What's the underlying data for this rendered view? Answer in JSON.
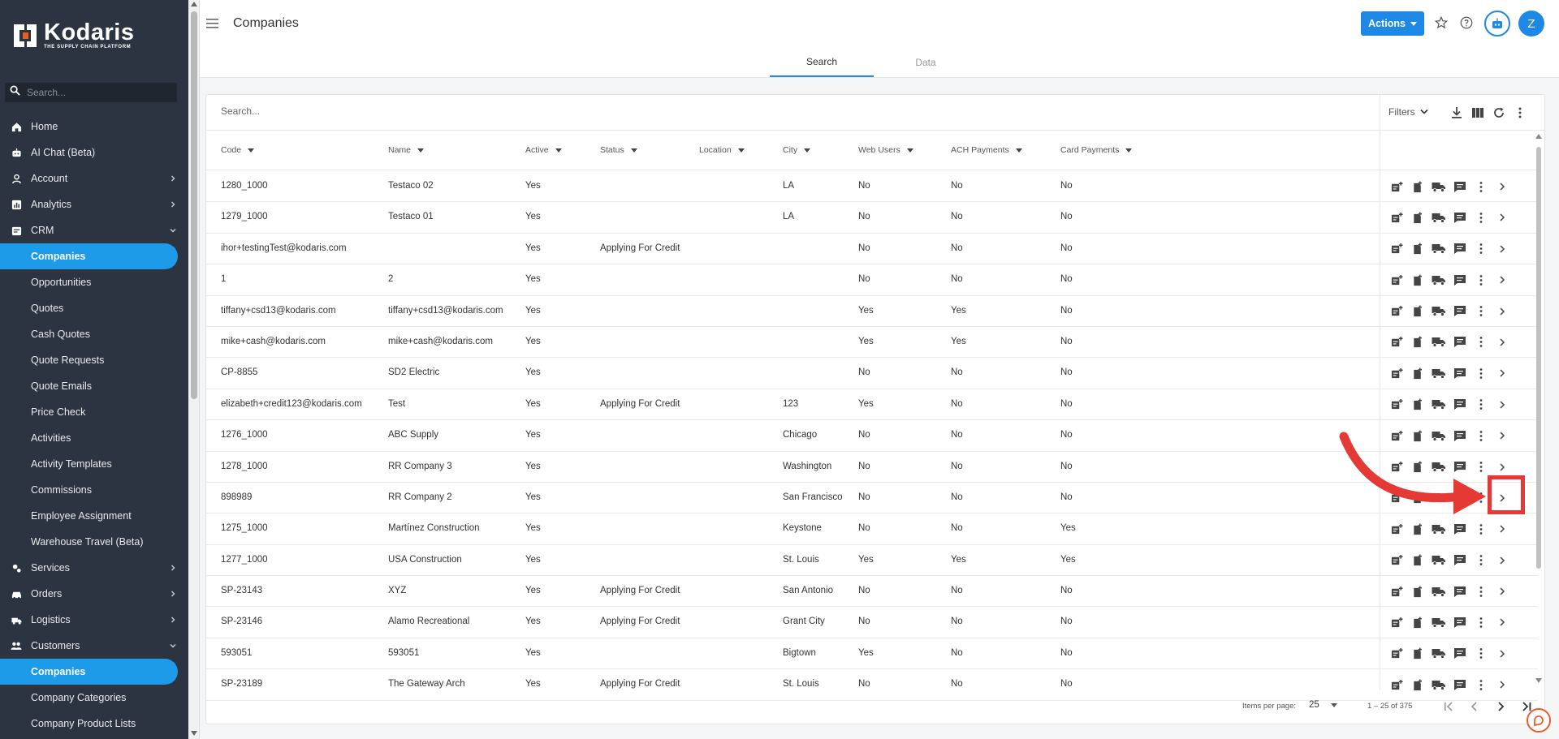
{
  "brand": {
    "name": "Kodaris",
    "tagline": "THE SUPPLY CHAIN PLATFORM"
  },
  "sidebar": {
    "search_placeholder": "Search...",
    "items": [
      {
        "label": "Home",
        "icon": "home-icon",
        "type": "top"
      },
      {
        "label": "AI Chat (Beta)",
        "icon": "robot-icon",
        "type": "top"
      },
      {
        "label": "Account",
        "icon": "person-icon",
        "type": "top",
        "chevron": "right"
      },
      {
        "label": "Analytics",
        "icon": "analytics-icon",
        "type": "top",
        "chevron": "right"
      },
      {
        "label": "CRM",
        "icon": "crm-icon",
        "type": "top",
        "chevron": "down"
      },
      {
        "label": "Companies",
        "type": "sub",
        "active": true
      },
      {
        "label": "Opportunities",
        "type": "sub"
      },
      {
        "label": "Quotes",
        "type": "sub"
      },
      {
        "label": "Cash Quotes",
        "type": "sub"
      },
      {
        "label": "Quote Requests",
        "type": "sub"
      },
      {
        "label": "Quote Emails",
        "type": "sub"
      },
      {
        "label": "Price Check",
        "type": "sub"
      },
      {
        "label": "Activities",
        "type": "sub"
      },
      {
        "label": "Activity Templates",
        "type": "sub"
      },
      {
        "label": "Commissions",
        "type": "sub"
      },
      {
        "label": "Employee Assignment",
        "type": "sub"
      },
      {
        "label": "Warehouse Travel (Beta)",
        "type": "sub"
      },
      {
        "label": "Services",
        "icon": "services-icon",
        "type": "top",
        "chevron": "right"
      },
      {
        "label": "Orders",
        "icon": "car-icon",
        "type": "top",
        "chevron": "right"
      },
      {
        "label": "Logistics",
        "icon": "truck-icon",
        "type": "top",
        "chevron": "right"
      },
      {
        "label": "Customers",
        "icon": "people-icon",
        "type": "top",
        "chevron": "down"
      },
      {
        "label": "Companies",
        "type": "sub",
        "active": true
      },
      {
        "label": "Company Categories",
        "type": "sub"
      },
      {
        "label": "Company Product Lists",
        "type": "sub"
      }
    ]
  },
  "header": {
    "title": "Companies",
    "actions_label": "Actions",
    "avatar_initial": "Z",
    "tabs": [
      {
        "label": "Search",
        "active": true
      },
      {
        "label": "Data",
        "active": false
      }
    ]
  },
  "grid": {
    "search_placeholder": "Search...",
    "filters_label": "Filters",
    "columns": [
      "Code",
      "Name",
      "Active",
      "Status",
      "Location",
      "City",
      "Web Users",
      "ACH Payments",
      "Card Payments"
    ],
    "rows": [
      [
        "1280_1000",
        "Testaco 02",
        "Yes",
        "",
        "",
        "LA",
        "No",
        "No",
        "No"
      ],
      [
        "1279_1000",
        "Testaco 01",
        "Yes",
        "",
        "",
        "LA",
        "No",
        "No",
        "No"
      ],
      [
        "ihor+testingTest@kodaris.com",
        "",
        "Yes",
        "Applying For Credit",
        "",
        "",
        "No",
        "No",
        "No"
      ],
      [
        "1",
        "2",
        "Yes",
        "",
        "",
        "",
        "No",
        "No",
        "No"
      ],
      [
        "tiffany+csd13@kodaris.com",
        "tiffany+csd13@kodaris.com",
        "Yes",
        "",
        "",
        "",
        "Yes",
        "Yes",
        "No"
      ],
      [
        "mike+cash@kodaris.com",
        "mike+cash@kodaris.com",
        "Yes",
        "",
        "",
        "",
        "Yes",
        "Yes",
        "No"
      ],
      [
        "CP-8855",
        "SD2 Electric",
        "Yes",
        "",
        "",
        "",
        "No",
        "No",
        "No"
      ],
      [
        "elizabeth+credit123@kodaris.com",
        "Test",
        "Yes",
        "Applying For Credit",
        "",
        "123",
        "Yes",
        "No",
        "No"
      ],
      [
        "1276_1000",
        "ABC Supply",
        "Yes",
        "",
        "",
        "Chicago",
        "No",
        "No",
        "No"
      ],
      [
        "1278_1000",
        "RR Company 3",
        "Yes",
        "",
        "",
        "Washington",
        "No",
        "No",
        "No"
      ],
      [
        "898989",
        "RR Company 2",
        "Yes",
        "",
        "",
        "San Francisco",
        "No",
        "No",
        "No"
      ],
      [
        "1275_1000",
        "Martínez Construction",
        "Yes",
        "",
        "",
        "Keystone",
        "No",
        "No",
        "Yes"
      ],
      [
        "1277_1000",
        "USA Construction",
        "Yes",
        "",
        "",
        "St. Louis",
        "Yes",
        "Yes",
        "Yes"
      ],
      [
        "SP-23143",
        "XYZ",
        "Yes",
        "Applying For Credit",
        "",
        "San Antonio",
        "No",
        "No",
        "No"
      ],
      [
        "SP-23146",
        "Alamo Recreational",
        "Yes",
        "Applying For Credit",
        "",
        "Grant City",
        "No",
        "No",
        "No"
      ],
      [
        "593051",
        "593051",
        "Yes",
        "",
        "",
        "Bigtown",
        "Yes",
        "No",
        "No"
      ],
      [
        "SP-23189",
        "The Gateway Arch",
        "Yes",
        "Applying For Credit",
        "",
        "St. Louis",
        "No",
        "No",
        "No"
      ]
    ],
    "row_actions": [
      "add-note-icon",
      "add-document-icon",
      "truck-icon",
      "comment-icon",
      "more-vert-icon",
      "chevron-right-icon"
    ],
    "pagination": {
      "items_per_page_label": "Items per page:",
      "items_per_page": "25",
      "range": "1 – 25 of 375"
    }
  },
  "colors": {
    "accent": "#1e88e5",
    "sidebar_bg": "#2b3440",
    "highlight": "#e53935"
  }
}
